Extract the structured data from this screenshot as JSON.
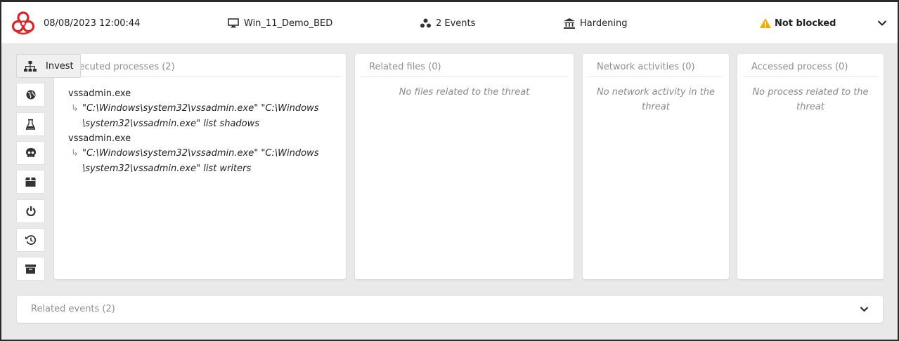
{
  "header": {
    "timestamp": "08/08/2023 12:00:44",
    "computer": "Win_11_Demo_BED",
    "events": "2 Events",
    "category": "Hardening",
    "status": "Not blocked",
    "icons": [
      "biohazard-icon",
      "monitor-icon",
      "events-icon",
      "bank-icon",
      "warning-icon",
      "chevron-down-icon"
    ]
  },
  "sidebar": {
    "tooltip": "Invest",
    "buttons": [
      "sitemap-icon",
      "globe-icon",
      "flask-icon",
      "skull-icon",
      "box-icon",
      "power-icon",
      "history-icon",
      "archive-icon"
    ]
  },
  "panels": {
    "executed": {
      "title": "Executed processes (2)",
      "items": [
        {
          "name": "vssadmin.exe",
          "cmd_line1": "\"C:\\Windows\\system32\\vssadmin.exe\" \"C:\\Windows",
          "cmd_line2": "\\system32\\vssadmin.exe\" list shadows"
        },
        {
          "name": "vssadmin.exe",
          "cmd_line1": "\"C:\\Windows\\system32\\vssadmin.exe\" \"C:\\Windows",
          "cmd_line2": "\\system32\\vssadmin.exe\" list writers"
        }
      ]
    },
    "files": {
      "title": "Related files (0)",
      "empty": "No files related to the threat"
    },
    "network": {
      "title": "Network activities (0)",
      "empty_line1": "No network activity in the",
      "empty_line2": "threat"
    },
    "accessed": {
      "title": "Accessed process (0)",
      "empty_line1": "No process related to the",
      "empty_line2": "threat"
    }
  },
  "related_events": {
    "title": "Related events (2)"
  },
  "colors": {
    "status": "#f0ad00",
    "biohazard": "#d9262b",
    "background": "#e9e9e9"
  }
}
